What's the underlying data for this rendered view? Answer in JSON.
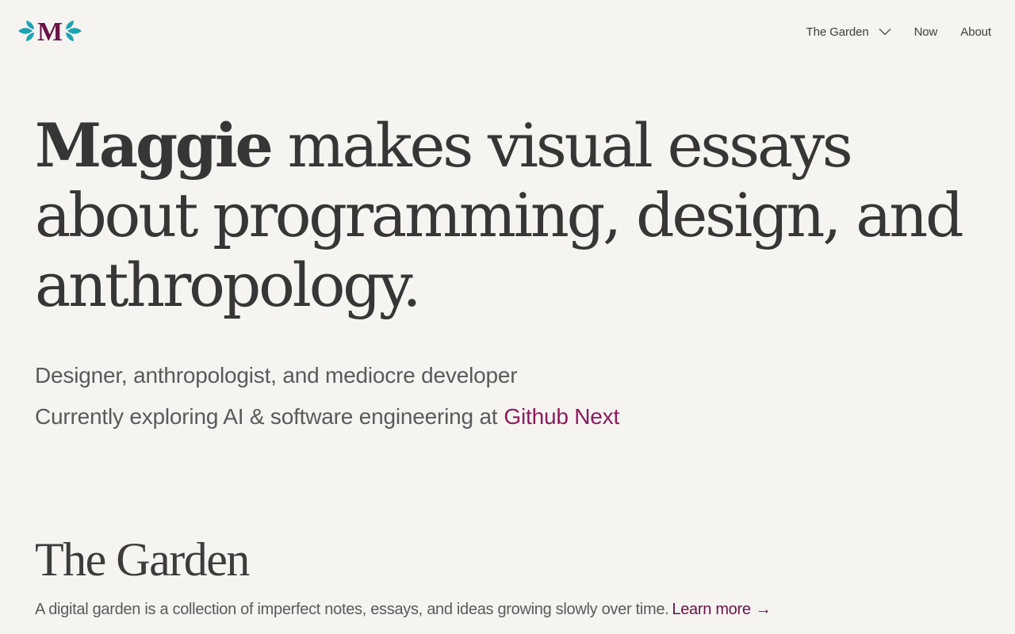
{
  "header": {
    "logo_letter": "M",
    "nav": [
      {
        "label": "The Garden",
        "has_dropdown": true
      },
      {
        "label": "Now"
      },
      {
        "label": "About"
      }
    ]
  },
  "hero": {
    "name": "Maggie",
    "headline_rest": " makes visual essays about programming, design, and anthropology."
  },
  "intro": {
    "line1": "Designer, anthropologist, and mediocre developer",
    "line2_prefix": "Currently exploring AI & software engineering at",
    "line2_link": "Github Next"
  },
  "garden": {
    "title": "The Garden",
    "description": "A digital garden is a collection of imperfect notes, essays, and ideas growing slowly over time.",
    "learn_more": "Learn more",
    "arrow": "→"
  },
  "colors": {
    "background": "#f5f4f1",
    "text": "#363636",
    "accent": "#8e1a5d",
    "logo_leaf": "#1aa3b3",
    "logo_letter": "#6a1248"
  },
  "icons": {
    "logo_leaves": "leaf-icon",
    "dropdown": "chevron-down-icon",
    "learn_more": "arrow-right-icon"
  }
}
